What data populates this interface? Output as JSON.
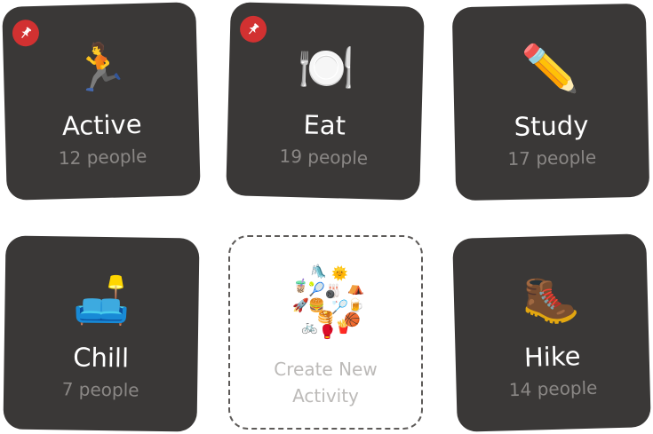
{
  "activities": [
    {
      "title": "Active",
      "count": "12 people",
      "emoji": "🏃",
      "pinned": true
    },
    {
      "title": "Eat",
      "count": "19 people",
      "emoji": "🍽️",
      "pinned": true
    },
    {
      "title": "Study",
      "count": "17 people",
      "emoji": "✏️",
      "pinned": false
    },
    {
      "title": "Chill",
      "count": "7 people",
      "emoji": "🛋️",
      "pinned": false
    },
    {
      "title": "Hike",
      "count": "14 people",
      "emoji": "🥾",
      "pinned": false
    }
  ],
  "create": {
    "label_line1": "Create New",
    "label_line2": "Activity",
    "collage": [
      "🧋",
      "🛝",
      "🌞",
      "🎾",
      "🎳",
      "⛺",
      "🚀",
      "🍔",
      "🏸",
      "🍺",
      "🥞",
      "🚲",
      "🥊",
      "🍟",
      "🏀"
    ]
  },
  "colors": {
    "tile_background": "#3a3837",
    "title_text": "#ffffff",
    "count_text": "#8a8785",
    "pin_badge": "#d23131",
    "create_border": "#5d5a58",
    "create_label": "#bcbab8"
  }
}
